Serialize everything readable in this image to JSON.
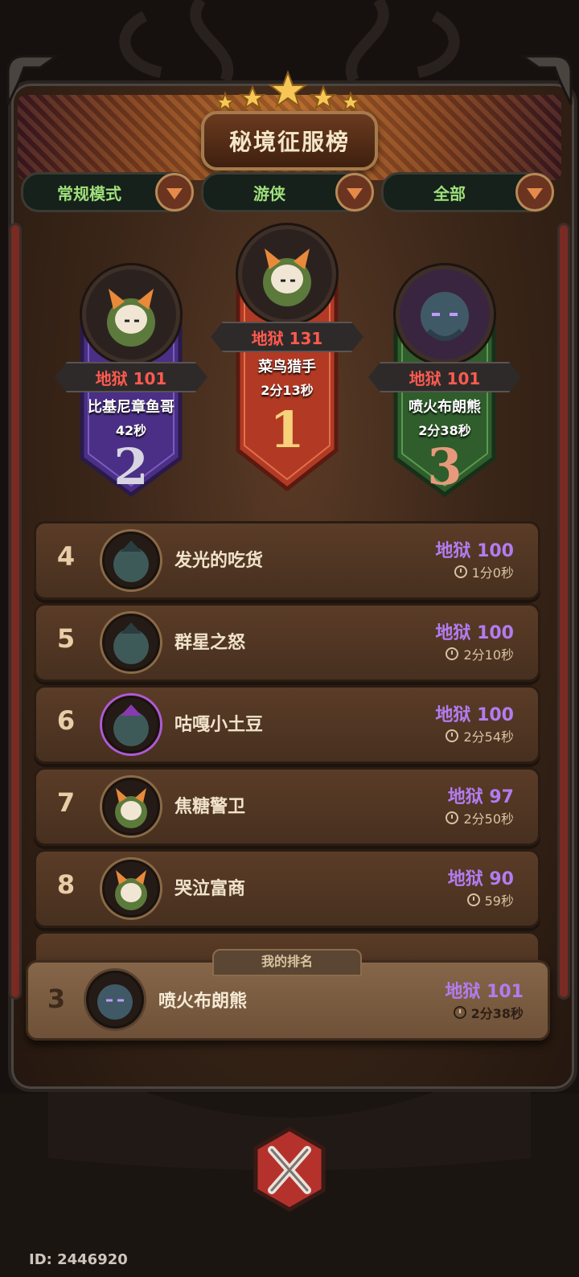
{
  "title": "秘境征服榜",
  "filters": [
    {
      "label": "常规模式"
    },
    {
      "label": "游侠"
    },
    {
      "label": "全部"
    }
  ],
  "podium": {
    "first": {
      "rank": "1",
      "score": "地狱 131",
      "name": "菜鸟猎手",
      "time": "2分13秒"
    },
    "second": {
      "rank": "2",
      "score": "地狱 101",
      "name": "比基尼章鱼哥",
      "time": "42秒"
    },
    "third": {
      "rank": "3",
      "score": "地狱 101",
      "name": "喷火布朗熊",
      "time": "2分38秒"
    }
  },
  "rows": [
    {
      "rank": "4",
      "name": "发光的吃货",
      "score": "地狱 100",
      "time": "1分0秒"
    },
    {
      "rank": "5",
      "name": "群星之怒",
      "score": "地狱 100",
      "time": "2分10秒"
    },
    {
      "rank": "6",
      "name": "咕嘎小土豆",
      "score": "地狱 100",
      "time": "2分54秒"
    },
    {
      "rank": "7",
      "name": "焦糖警卫",
      "score": "地狱 97",
      "time": "2分50秒"
    },
    {
      "rank": "8",
      "name": "哭泣富商",
      "score": "地狱 90",
      "time": "59秒"
    }
  ],
  "my_rank": {
    "tab_label": "我的排名",
    "rank": "3",
    "name": "喷火布朗熊",
    "score": "地狱 101",
    "time": "2分38秒"
  },
  "footer": {
    "id_text": "ID: 2446920"
  },
  "colors": {
    "score_purple": "#b27cf0",
    "hell_red": "#ff5a4f",
    "filter_green": "#9fe07b"
  }
}
